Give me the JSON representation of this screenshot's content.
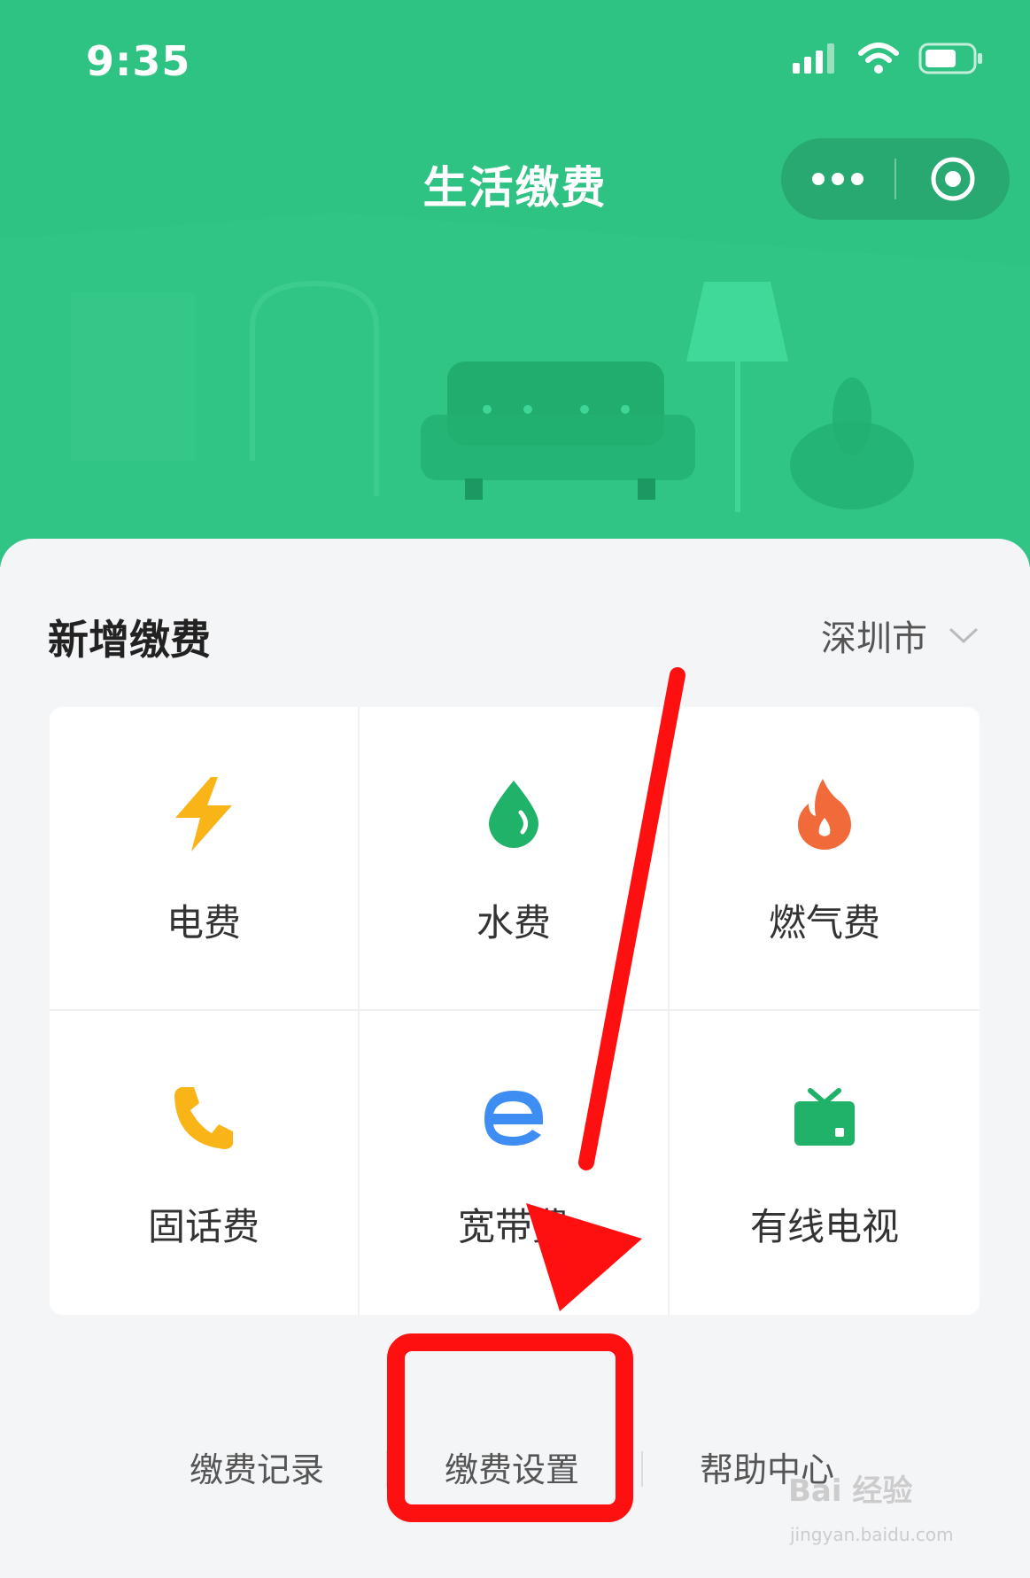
{
  "status_bar": {
    "time": "9:35"
  },
  "header": {
    "title": "生活缴费"
  },
  "section": {
    "title": "新增缴费",
    "city": "深圳市"
  },
  "services": [
    {
      "label": "电费",
      "icon": "lightning-icon",
      "color": "#f9b418"
    },
    {
      "label": "水费",
      "icon": "water-drop-icon",
      "color": "#21b26a"
    },
    {
      "label": "燃气费",
      "icon": "flame-icon",
      "color": "#f06a3a"
    },
    {
      "label": "固话费",
      "icon": "phone-icon",
      "color": "#f9b418"
    },
    {
      "label": "宽带费",
      "icon": "browser-e-icon",
      "color": "#3d8df2"
    },
    {
      "label": "有线电视",
      "icon": "tv-icon",
      "color": "#21b26a"
    }
  ],
  "footer_links": {
    "records": "缴费记录",
    "settings": "缴费设置",
    "help": "帮助中心"
  },
  "watermark": {
    "brand": "Bai 经验",
    "url": "jingyan.baidu.com"
  },
  "colors": {
    "brand_green": "#2fc383",
    "highlight_red": "#ff1010"
  }
}
